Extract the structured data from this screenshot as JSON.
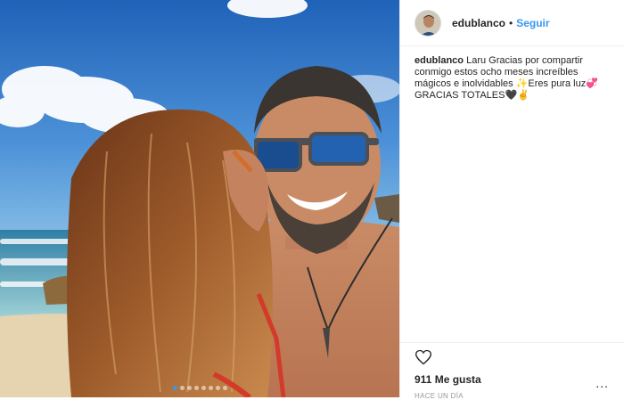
{
  "post": {
    "image_alt": "Selfie de pareja en la playa",
    "carousel": {
      "count": 8,
      "active_index": 0
    }
  },
  "header": {
    "username": "edublanco",
    "separator": "•",
    "follow_label": "Seguir"
  },
  "caption": {
    "username": "edublanco",
    "text": "Laru Gracias por compartir conmigo estos ocho meses increíbles mágicos e inolvidables ✨Eres pura luz💞 GRACIAS TOTALES🖤✌️"
  },
  "actions": {
    "like_icon": "heart-outline-icon",
    "likes_text": "911 Me gusta",
    "timestamp": "HACE UN DÍA",
    "more_label": "..."
  },
  "colors": {
    "link": "#3897f0",
    "text": "#262626",
    "muted": "#999999",
    "border": "#efefef"
  }
}
